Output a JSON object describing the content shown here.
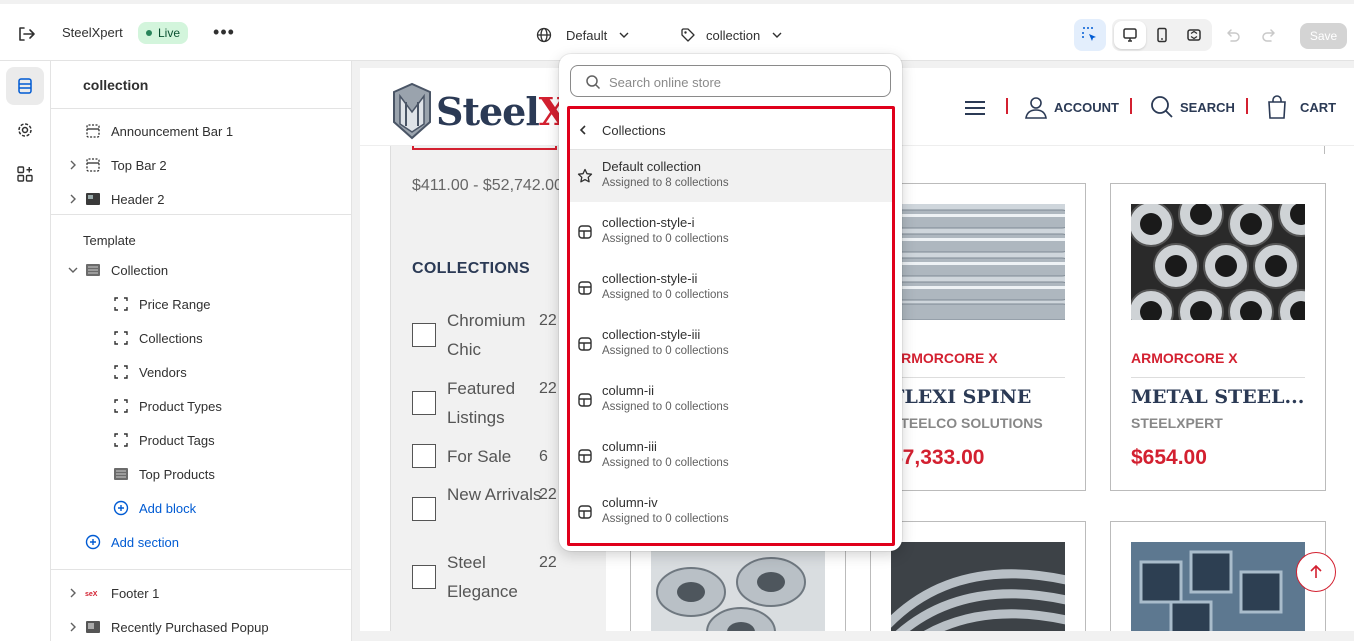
{
  "topbar": {
    "store_name": "SteelXpert",
    "status_badge": "Live",
    "more_label": "•••",
    "theme_selector": "Default",
    "template_selector": "collection",
    "save_label": "Save"
  },
  "sidebar": {
    "title": "collection",
    "header_sections": [
      {
        "label": "Announcement Bar 1"
      },
      {
        "label": "Top Bar 2"
      },
      {
        "label": "Header 2"
      }
    ],
    "template_label": "Template",
    "template_section": "Collection",
    "blocks": [
      {
        "label": "Price Range"
      },
      {
        "label": "Collections"
      },
      {
        "label": "Vendors"
      },
      {
        "label": "Product Types"
      },
      {
        "label": "Product Tags"
      },
      {
        "label": "Top Products"
      }
    ],
    "add_block": "Add block",
    "add_section": "Add section",
    "footer_sections": [
      {
        "label": "Footer 1"
      },
      {
        "label": "Recently Purchased Popup"
      }
    ]
  },
  "dropdown": {
    "search_placeholder": "Search online store",
    "back_label": "Collections",
    "options": [
      {
        "name": "Default collection",
        "sub": "Assigned to 8 collections",
        "icon": "star-icon",
        "selected": true
      },
      {
        "name": "collection-style-i",
        "sub": "Assigned to 0 collections",
        "icon": "template-icon",
        "selected": false
      },
      {
        "name": "collection-style-ii",
        "sub": "Assigned to 0 collections",
        "icon": "template-icon",
        "selected": false
      },
      {
        "name": "collection-style-iii",
        "sub": "Assigned to 0 collections",
        "icon": "template-icon",
        "selected": false
      },
      {
        "name": "column-ii",
        "sub": "Assigned to 0 collections",
        "icon": "template-icon",
        "selected": false
      },
      {
        "name": "column-iii",
        "sub": "Assigned to 0 collections",
        "icon": "template-icon",
        "selected": false
      },
      {
        "name": "column-iv",
        "sub": "Assigned to 0 collections",
        "icon": "template-icon",
        "selected": false
      }
    ],
    "highlight_color": "#e0001b"
  },
  "preview": {
    "logo_text_main": "Steel",
    "logo_text_accent": "X",
    "nav": {
      "account": "ACCOUNT",
      "search": "SEARCH",
      "cart": "CART"
    },
    "price_range": "$411.00 - $52,742.00",
    "collections_title": "COLLECTIONS",
    "filters": [
      {
        "name": "Chromium Chic",
        "count": "22"
      },
      {
        "name": "Featured Listings",
        "count": "22"
      },
      {
        "name": "For Sale",
        "count": "6"
      },
      {
        "name": "New Arrivals",
        "count": "22"
      },
      {
        "name": "Steel Elegance",
        "count": "22"
      }
    ],
    "products": [
      {
        "brand": "ARMORCORE X",
        "name": "FLEXI SPINE",
        "vendor": "STEELCO SOLUTIONS",
        "price": "$7,333.00"
      },
      {
        "brand": "ARMORCORE X",
        "name": "METAL STEEL...",
        "vendor": "STEELXPERT",
        "price": "$654.00"
      }
    ],
    "accent_color": "#d32030",
    "navy_color": "#2b3a55"
  }
}
